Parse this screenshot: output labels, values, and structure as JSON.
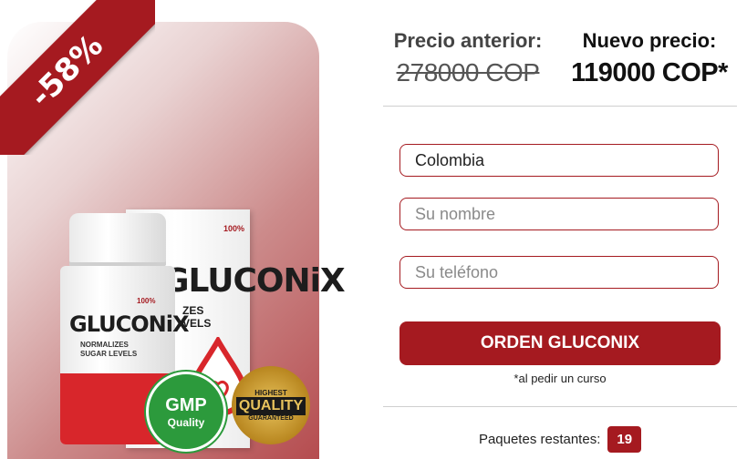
{
  "discount": {
    "label": "-58%"
  },
  "product": {
    "brand": "GLUCONiX",
    "badge": "100%",
    "tagline_line1": "NORMALIZES",
    "tagline_line2": "SUGAR LEVELS",
    "box_line1": "ZES",
    "box_line2": "VELS",
    "gmp_big": "GMP",
    "gmp_small": "Quality",
    "quality_top": "HIGHEST",
    "quality_main": "QUALITY",
    "quality_bottom": "GUARANTEED"
  },
  "pricing": {
    "old_label": "Precio anterior:",
    "old_value": "278000 COP",
    "new_label": "Nuevo precio:",
    "new_value": "119000 COP*"
  },
  "form": {
    "country_value": "Colombia",
    "name_placeholder": "Su nombre",
    "phone_placeholder": "Su teléfono",
    "submit_label": "ORDEN GLUCONIX",
    "note": "*al pedir un curso"
  },
  "stock": {
    "label": "Paquetes restantes:",
    "count": "19"
  },
  "colors": {
    "accent": "#a51a20",
    "green": "#2c9a3c",
    "gold": "#c9a23a"
  }
}
